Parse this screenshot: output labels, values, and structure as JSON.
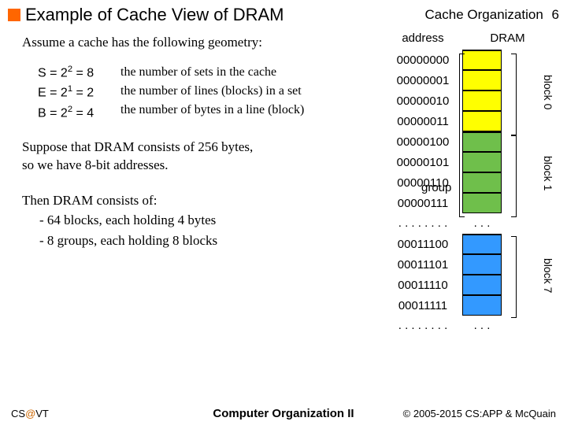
{
  "header": {
    "title": "Example of Cache View of DRAM",
    "section": "Cache Organization",
    "page": "6"
  },
  "assume": "Assume a cache has the following geometry:",
  "geom": {
    "s_lhs": "S = 2",
    "s_exp": "2",
    "s_rhs": " = 8",
    "e_lhs": "E = 2",
    "e_exp": "1",
    "e_rhs": " = 2",
    "b_lhs": "B = 2",
    "b_exp": "2",
    "b_rhs": " = 4",
    "s_desc": "the number of sets in the cache",
    "e_desc": "the number of lines (blocks) in a set",
    "b_desc": "the number of bytes in a line (block)"
  },
  "suppose1": "Suppose that DRAM consists of 256 bytes,",
  "suppose2": "so we have 8-bit addresses.",
  "then_intro": "Then DRAM consists of:",
  "then_b1": "-  64 blocks, each holding 4 bytes",
  "then_b2": "-  8 groups, each holding 8 blocks",
  "dram": {
    "addr_h": "address",
    "dram_h": "DRAM",
    "group_label": "group",
    "block0": "block 0",
    "block1": "block 1",
    "block7": "block 7",
    "rows": [
      "00000000",
      "00000001",
      "00000010",
      "00000011",
      "00000100",
      "00000101",
      "00000110",
      "00000111",
      "00011100",
      "00011101",
      "00011110",
      "00011111"
    ],
    "dots": ". . . . . . . .",
    "dots_c": ". . ."
  },
  "footer": {
    "left_a": "CS",
    "left_at": "@",
    "left_b": "VT",
    "center": "Computer Organization II",
    "right": "© 2005-2015 CS:APP & McQuain"
  }
}
